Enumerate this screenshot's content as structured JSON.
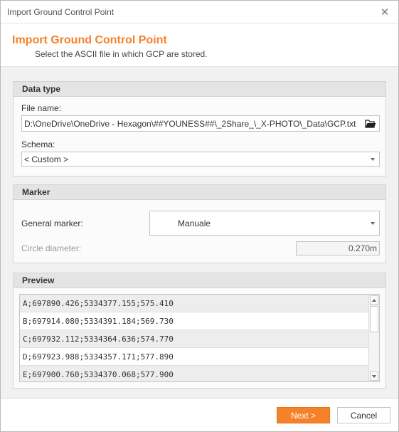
{
  "window": {
    "title": "Import Ground Control Point",
    "close_glyph": "✕"
  },
  "header": {
    "title": "Import Ground Control Point",
    "subtitle": "Select the ASCII file in which GCP are stored."
  },
  "data_type": {
    "heading": "Data type",
    "file_name_label": "File name:",
    "file_name_value": "D:\\OneDrive\\OneDrive - Hexagon\\##YOUNESS##\\_2Share_\\_X-PHOTO\\_Data\\GCP.txt",
    "folder_icon": "folder-open-icon",
    "schema_label": "Schema:",
    "schema_value": "< Custom >"
  },
  "marker": {
    "heading": "Marker",
    "general_marker_label": "General marker:",
    "general_marker_value": "Manuale",
    "circle_diameter_label": "Circle diameter:",
    "circle_diameter_value": "0.270m"
  },
  "preview": {
    "heading": "Preview",
    "rows": [
      "A;697890.426;5334377.155;575.410",
      "B;697914.080;5334391.184;569.730",
      "C;697932.112;5334364.636;574.770",
      "D;697923.988;5334357.171;577.890",
      "E;697900.760;5334370.068;577.900"
    ]
  },
  "footer": {
    "next_label": "Next >",
    "cancel_label": "Cancel"
  },
  "colors": {
    "accent": "#f5822a",
    "panel_bg": "#f1f1f1",
    "group_header": "#e4e4e4"
  }
}
